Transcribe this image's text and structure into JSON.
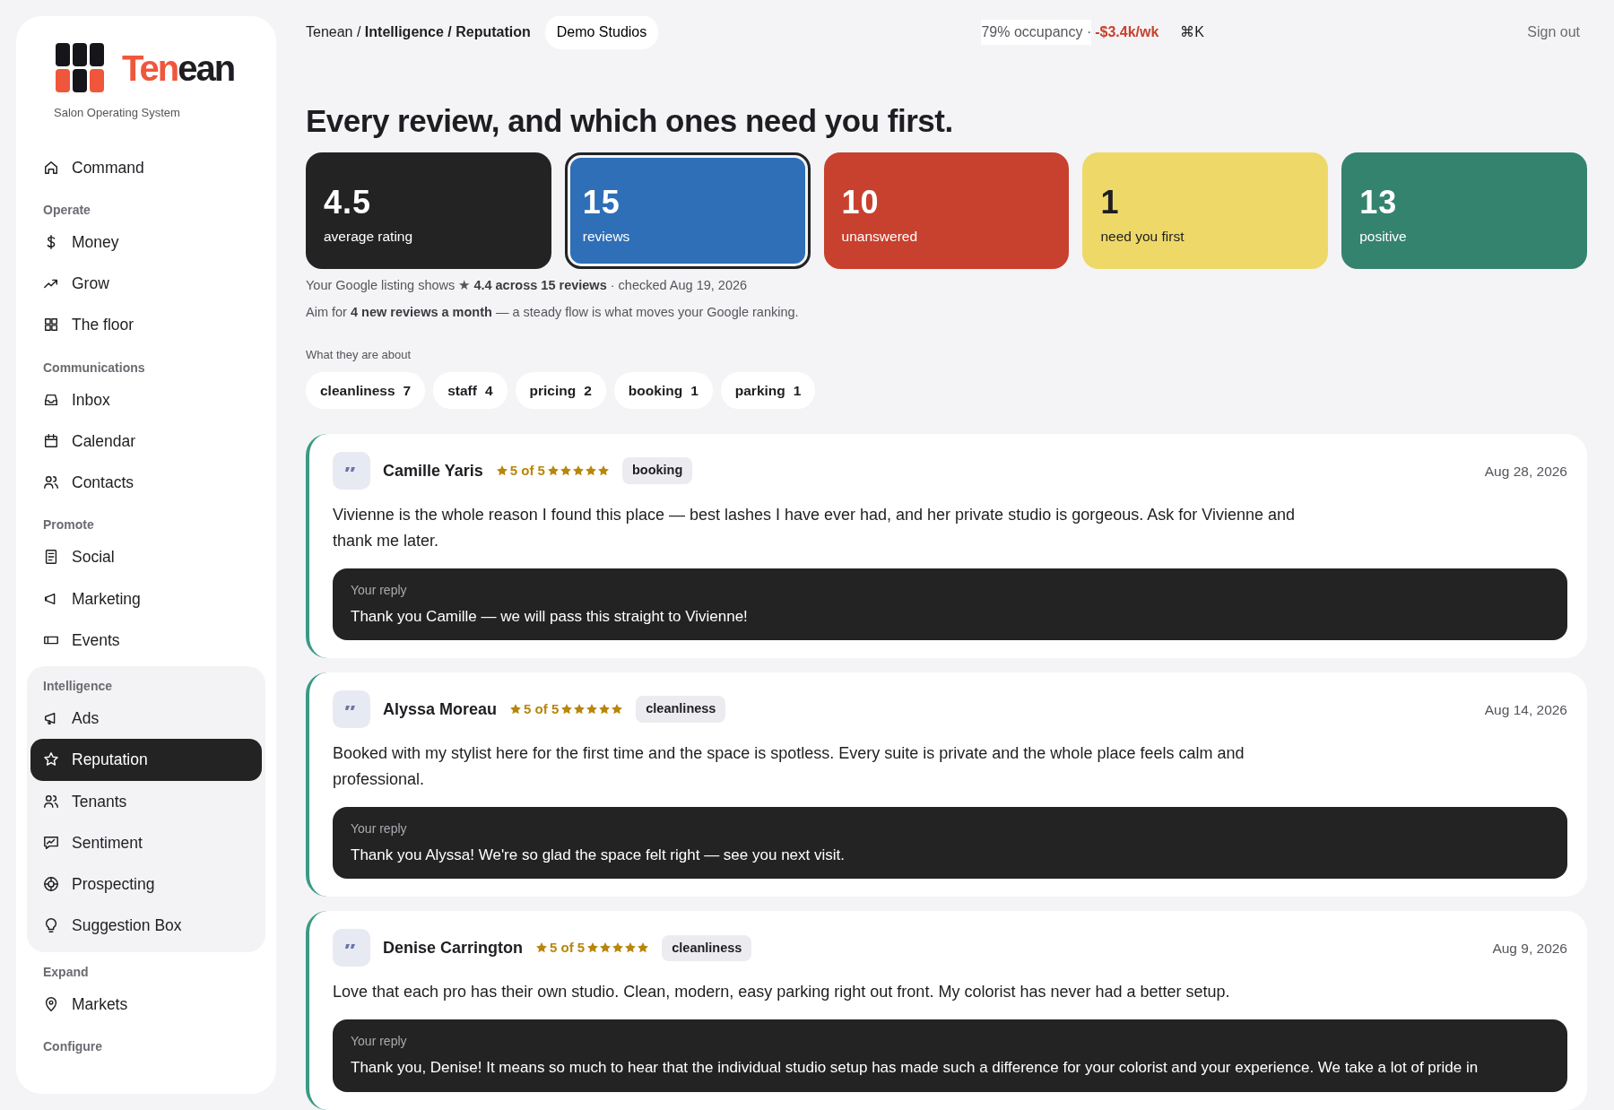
{
  "sidebar": {
    "logo": {
      "accent": "Ten",
      "rest": "ean"
    },
    "tagline": "Salon Operating System",
    "sections": [
      {
        "highlighted": false,
        "items": [
          {
            "label": "Command",
            "selected": false
          }
        ]
      },
      {
        "heading": "Operate",
        "highlighted": false,
        "items": [
          {
            "label": "Money",
            "selected": false
          },
          {
            "label": "Grow",
            "selected": false
          },
          {
            "label": "The floor",
            "selected": false
          }
        ]
      },
      {
        "heading": "Communications",
        "highlighted": false,
        "items": [
          {
            "label": "Inbox",
            "selected": false
          },
          {
            "label": "Calendar",
            "selected": false
          },
          {
            "label": "Contacts",
            "selected": false
          }
        ]
      },
      {
        "heading": "Promote",
        "highlighted": false,
        "items": [
          {
            "label": "Social",
            "selected": false
          },
          {
            "label": "Marketing",
            "selected": false
          },
          {
            "label": "Events",
            "selected": false
          }
        ]
      },
      {
        "heading": "Intelligence",
        "highlighted": true,
        "items": [
          {
            "label": "Ads",
            "selected": false
          },
          {
            "label": "Reputation",
            "selected": true
          },
          {
            "label": "Tenants",
            "selected": false
          },
          {
            "label": "Sentiment",
            "selected": false
          },
          {
            "label": "Prospecting",
            "selected": false
          },
          {
            "label": "Suggestion Box",
            "selected": false
          }
        ]
      },
      {
        "heading": "Expand",
        "highlighted": false,
        "items": [
          {
            "label": "Markets",
            "selected": false
          }
        ]
      },
      {
        "heading": "Configure",
        "highlighted": false
      }
    ]
  },
  "header": {
    "breadcrumb": "Tenean / **Intelligence / Reputation**",
    "workspace": "Demo Studios",
    "occupancy": "79% occupancy ·",
    "delta": "-$3.4k/wk",
    "shortcut": "⌘K",
    "sign_out": "Sign out"
  },
  "title": "Every review, and which ones need you first.",
  "stats": [
    {
      "value": "4.5",
      "label": "average rating",
      "color": "#232323",
      "selected": false
    },
    {
      "value": "15",
      "label": "reviews",
      "color": "#2e6fb7",
      "selected": true
    },
    {
      "value": "10",
      "label": "unanswered",
      "color": "#c8412e",
      "selected": false
    },
    {
      "value": "1",
      "label": "need you first",
      "color": "#eed968",
      "selected": false
    },
    {
      "value": "13",
      "label": "positive",
      "color": "#33836f",
      "selected": false
    }
  ],
  "notes": [
    "Your Google listing shows ★ **4.4 across 15 reviews** · checked Aug 19, 2026",
    "Aim for **4 new reviews a month** — a steady flow is what moves your Google ranking."
  ],
  "topics": {
    "heading": "What they are about",
    "items": [
      {
        "label": "cleanliness",
        "count": "7"
      },
      {
        "label": "staff",
        "count": "4"
      },
      {
        "label": "pricing",
        "count": "2"
      },
      {
        "label": "booking",
        "count": "1"
      },
      {
        "label": "parking",
        "count": "1"
      }
    ]
  },
  "reviews": [
    {
      "name": "Camille Yaris",
      "rating": "5 of 5",
      "stars": 5,
      "tag": "booking",
      "date": "Aug 28, 2026",
      "text": "Vivienne is the whole reason I found this place — best lashes I have ever had, and her private studio is gorgeous. Ask for Vivienne and thank me later.",
      "reply_label": "Your reply",
      "reply": "Thank you Camille — we will pass this straight to Vivienne!"
    },
    {
      "name": "Alyssa Moreau",
      "rating": "5 of 5",
      "stars": 5,
      "tag": "cleanliness",
      "date": "Aug 14, 2026",
      "text": "Booked with my stylist here for the first time and the space is spotless. Every suite is private and the whole place feels calm and professional.",
      "reply_label": "Your reply",
      "reply": "Thank you Alyssa! We're so glad the space felt right — see you next visit."
    },
    {
      "name": "Denise Carrington",
      "rating": "5 of 5",
      "stars": 5,
      "tag": "cleanliness",
      "date": "Aug 9, 2026",
      "text": "Love that each pro has their own studio. Clean, modern, easy parking right out front. My colorist has never had a better setup.",
      "reply_label": "Your reply",
      "reply": "Thank you, Denise! It means so much to hear that the individual studio setup has made such a difference for your colorist and your experience. We take a lot of pride in"
    }
  ]
}
